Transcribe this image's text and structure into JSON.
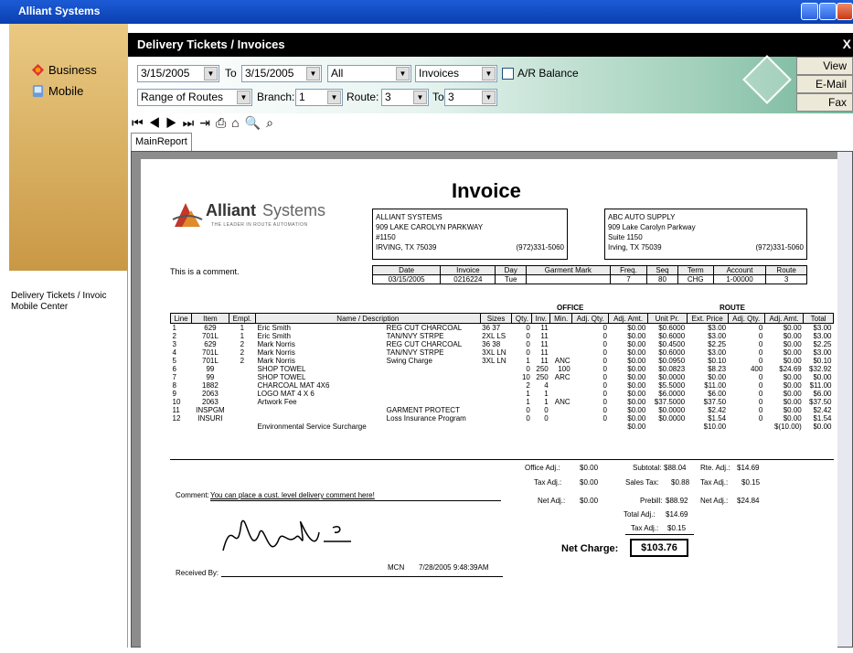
{
  "window": {
    "title": "Alliant Systems"
  },
  "sidebar": {
    "items": [
      {
        "label": "Business"
      },
      {
        "label": "Mobile"
      }
    ],
    "list": [
      "Delivery Tickets / Invoic",
      "Mobile Center"
    ]
  },
  "header": {
    "title": "Delivery Tickets / Invoices",
    "close": "X"
  },
  "filters": {
    "date_from": "3/15/2005",
    "to_label": "To",
    "date_to": "3/15/2005",
    "status": "All",
    "doc_type": "Invoices",
    "ar_label": "A/R Balance",
    "range": "Range of Routes",
    "branch_label": "Branch:",
    "branch": "1",
    "route_label": "Route:",
    "route": "3",
    "to2_label": "To",
    "route_to": "3"
  },
  "actions": {
    "view": "View",
    "email": "E-Mail",
    "fax": "Fax"
  },
  "report_toolbar": {
    "tab": "MainReport"
  },
  "invoice": {
    "title": "Invoice",
    "logo_name": "Alliant Systems",
    "logo_tag": "The Leader in Route Automation",
    "from": [
      "ALLIANT SYSTEMS",
      "909 LAKE CAROLYN PARKWAY",
      "#1150",
      "IRVING, TX 75039"
    ],
    "from_phone": "(972)331-5060",
    "to": [
      "ABC AUTO SUPPLY",
      "909 Lake Carolyn Parkway",
      "Suite 1150",
      "Irving, TX 75039"
    ],
    "to_phone": "(972)331-5060",
    "comment": "This is a comment.",
    "info_headers": [
      "Date",
      "Invoice",
      "Day",
      "Garment Mark",
      "Freq.",
      "Seq",
      "Term",
      "Account",
      "Route"
    ],
    "info_values": [
      "03/15/2005",
      "0216224",
      "Tue",
      "",
      "7",
      "80",
      "CHG",
      "1-00000",
      "3"
    ],
    "office_label": "OFFICE",
    "route_label": "ROUTE",
    "columns": [
      "Line",
      "Item",
      "Empl.",
      "Name / Description",
      "Sizes",
      "Qty.",
      "Inv.",
      "Min.",
      "Adj. Qty.",
      "Adj. Amt.",
      "Unit Pr.",
      "Ext. Price",
      "Adj. Qty.",
      "Adj. Amt.",
      "Total"
    ],
    "rows": [
      [
        "1",
        "629",
        "1",
        "Eric Smith",
        "REG CUT CHARCOAL",
        "36 37",
        "0",
        "11",
        "",
        "0",
        "$0.00",
        "$0.6000",
        "$3.00",
        "0",
        "$0.00",
        "$3.00"
      ],
      [
        "2",
        "701L",
        "1",
        "Eric Smith",
        "TAN/NVY STRPE",
        "2XL LS",
        "0",
        "11",
        "",
        "0",
        "$0.00",
        "$0.6000",
        "$3.00",
        "0",
        "$0.00",
        "$3.00"
      ],
      [
        "3",
        "629",
        "2",
        "Mark Norris",
        "REG CUT CHARCOAL",
        "36 38",
        "0",
        "11",
        "",
        "0",
        "$0.00",
        "$0.4500",
        "$2.25",
        "0",
        "$0.00",
        "$2.25"
      ],
      [
        "4",
        "701L",
        "2",
        "Mark Norris",
        "TAN/NVY STRPE",
        "3XL LN",
        "0",
        "11",
        "",
        "0",
        "$0.00",
        "$0.6000",
        "$3.00",
        "0",
        "$0.00",
        "$3.00"
      ],
      [
        "5",
        "701L",
        "2",
        "Mark Norris",
        "Swing Charge",
        "3XL LN",
        "1",
        "11",
        "ANC",
        "0",
        "$0.00",
        "$0.0950",
        "$0.10",
        "0",
        "$0.00",
        "$0.10"
      ],
      [
        "6",
        "99",
        "",
        "SHOP TOWEL",
        "",
        "",
        "0",
        "250",
        "100",
        "0",
        "$0.00",
        "$0.0823",
        "$8.23",
        "400",
        "$24.69",
        "$32.92"
      ],
      [
        "7",
        "99",
        "",
        "SHOP TOWEL",
        "",
        "",
        "10",
        "250",
        "ARC",
        "0",
        "$0.00",
        "$0.0000",
        "$0.00",
        "0",
        "$0.00",
        "$0.00"
      ],
      [
        "8",
        "1882",
        "",
        "CHARCOAL MAT 4X6",
        "",
        "",
        "2",
        "4",
        "",
        "0",
        "$0.00",
        "$5.5000",
        "$11.00",
        "0",
        "$0.00",
        "$11.00"
      ],
      [
        "9",
        "2063",
        "",
        "LOGO MAT 4 X 6",
        "",
        "",
        "1",
        "1",
        "",
        "0",
        "$0.00",
        "$6.0000",
        "$6.00",
        "0",
        "$0.00",
        "$6.00"
      ],
      [
        "10",
        "2063",
        "",
        "Artwork Fee",
        "",
        "",
        "1",
        "1",
        "ANC",
        "0",
        "$0.00",
        "$37.5000",
        "$37.50",
        "0",
        "$0.00",
        "$37.50"
      ],
      [
        "11",
        "INSPGM",
        "",
        "",
        "GARMENT PROTECT",
        "",
        "0",
        "0",
        "",
        "0",
        "$0.00",
        "$0.0000",
        "$2.42",
        "0",
        "$0.00",
        "$2.42"
      ],
      [
        "12",
        "INSURI",
        "",
        "",
        "Loss Insurance Program",
        "",
        "0",
        "0",
        "",
        "0",
        "$0.00",
        "$0.0000",
        "$1.54",
        "0",
        "$0.00",
        "$1.54"
      ],
      [
        "",
        "",
        "",
        "Environmental Service Surcharge",
        "",
        "",
        "",
        "",
        "",
        "",
        "$0.00",
        "",
        "$10.00",
        "",
        "$(10.00)",
        "$0.00"
      ]
    ],
    "totals": {
      "office_adj_label": "Office Adj.:",
      "office_adj": "$0.00",
      "subtotal_label": "Subtotal:",
      "subtotal": "$88.04",
      "rte_adj_label": "Rte. Adj.:",
      "rte_adj": "$14.69",
      "tax_adj_label": "Tax Adj.:",
      "tax_adj": "$0.00",
      "sales_tax_label": "Sales Tax:",
      "sales_tax": "$0.88",
      "tax_adj2_label": "Tax Adj.:",
      "tax_adj2": "$0.15",
      "net_adj_label": "Net Adj.:",
      "net_adj": "$0.00",
      "prebill_label": "Prebill:",
      "prebill": "$88.92",
      "net_adj2_label": "Net Adj.:",
      "net_adj2": "$24.84",
      "total_adj_label": "Total Adj.:",
      "total_adj": "$14.69",
      "tax_adj3_label": "Tax Adj.:",
      "tax_adj3": "$0.15",
      "net_charge_label": "Net Charge:",
      "net_charge": "$103.76"
    },
    "comment_label": "Comment:",
    "comment_text": "You can place a cust. level delivery comment here!",
    "received_label": "Received By:",
    "driver": "MCN",
    "timestamp": "7/28/2005  9:48:39AM"
  }
}
